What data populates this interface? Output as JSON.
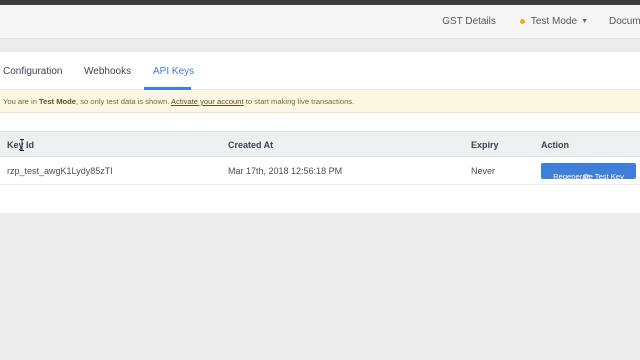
{
  "header": {
    "gst_details": "GST Details",
    "mode_label": "Test Mode",
    "mode_color": "#f5a623",
    "docs_label": "Documentation"
  },
  "tabs": [
    {
      "label": "Configuration",
      "active": false
    },
    {
      "label": "Webhooks",
      "active": false
    },
    {
      "label": "API Keys",
      "active": true
    }
  ],
  "banner": {
    "prefix": "You are in ",
    "mode": "Test Mode",
    "middle": ", so only test data is shown. ",
    "link": "Activate your account",
    "suffix": " to start making live transactions."
  },
  "table": {
    "columns": [
      "Key Id",
      "Created At",
      "Expiry",
      "Action"
    ],
    "rows": [
      {
        "key_id": "rzp_test_awgK1Lydy85zTI",
        "created_at": "Mar 17th, 2018 12:56:18 PM",
        "expiry": "Never",
        "action_label": "Regenerate Test Key"
      }
    ]
  },
  "colors": {
    "accent": "#3f7fdc",
    "banner_bg": "#fcf7e3"
  }
}
